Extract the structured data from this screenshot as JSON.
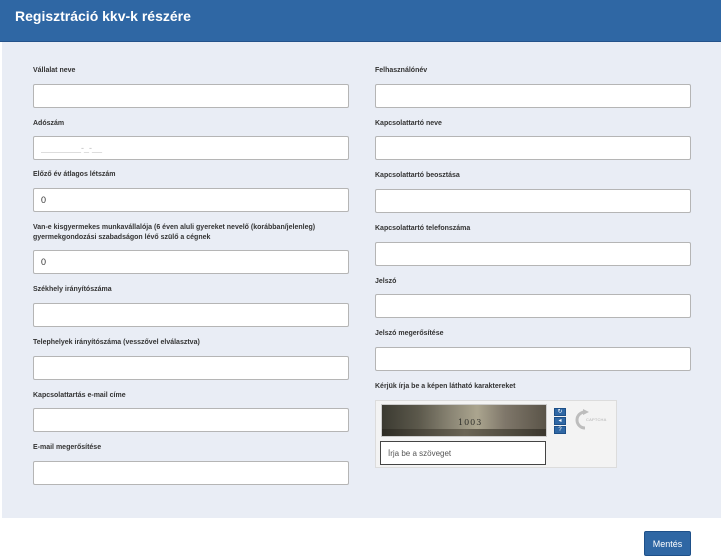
{
  "header": {
    "title": "Regisztráció kkv-k részére"
  },
  "left": {
    "company_name": {
      "label": "Vállalat neve",
      "value": ""
    },
    "tax_number": {
      "label": "Adószám",
      "value": "________-_-__"
    },
    "avg_headcount": {
      "label": "Előző év átlagos létszám",
      "value": "0"
    },
    "parental_leave": {
      "label": "Van-e kisgyermekes munkavállalója (6 éven aluli gyereket nevelő (korábban/jelenleg) gyermekgondozási szabadságon lévő szülő a cégnek",
      "value": "0"
    },
    "hq_zip": {
      "label": "Székhely irányítószáma",
      "value": ""
    },
    "site_zips": {
      "label": "Telephelyek irányítószáma (vesszővel elválasztva)",
      "value": ""
    },
    "contact_email": {
      "label": "Kapcsolattartás e-mail címe",
      "value": ""
    },
    "email_confirm": {
      "label": "E-mail megerősítése",
      "value": ""
    }
  },
  "right": {
    "username": {
      "label": "Felhasználónév",
      "value": ""
    },
    "contact_name": {
      "label": "Kapcsolattartó neve",
      "value": ""
    },
    "contact_position": {
      "label": "Kapcsolattartó beosztása",
      "value": ""
    },
    "contact_phone": {
      "label": "Kapcsolattartó telefonszáma",
      "value": ""
    },
    "password": {
      "label": "Jelszó",
      "value": ""
    },
    "password_confirm": {
      "label": "Jelszó megerősítése",
      "value": ""
    }
  },
  "captcha": {
    "label": "Kérjük írja be a képen látható karaktereket",
    "image_text": "1003",
    "input_placeholder": "Írja be a szöveget",
    "logo_text": "CAPTCHA",
    "refresh_icon": "refresh-icon",
    "audio_icon": "audio-icon",
    "help_icon": "help-icon"
  },
  "footer": {
    "save_label": "Mentés"
  },
  "colors": {
    "accent": "#2f67a4",
    "panel": "#e9edf5"
  }
}
